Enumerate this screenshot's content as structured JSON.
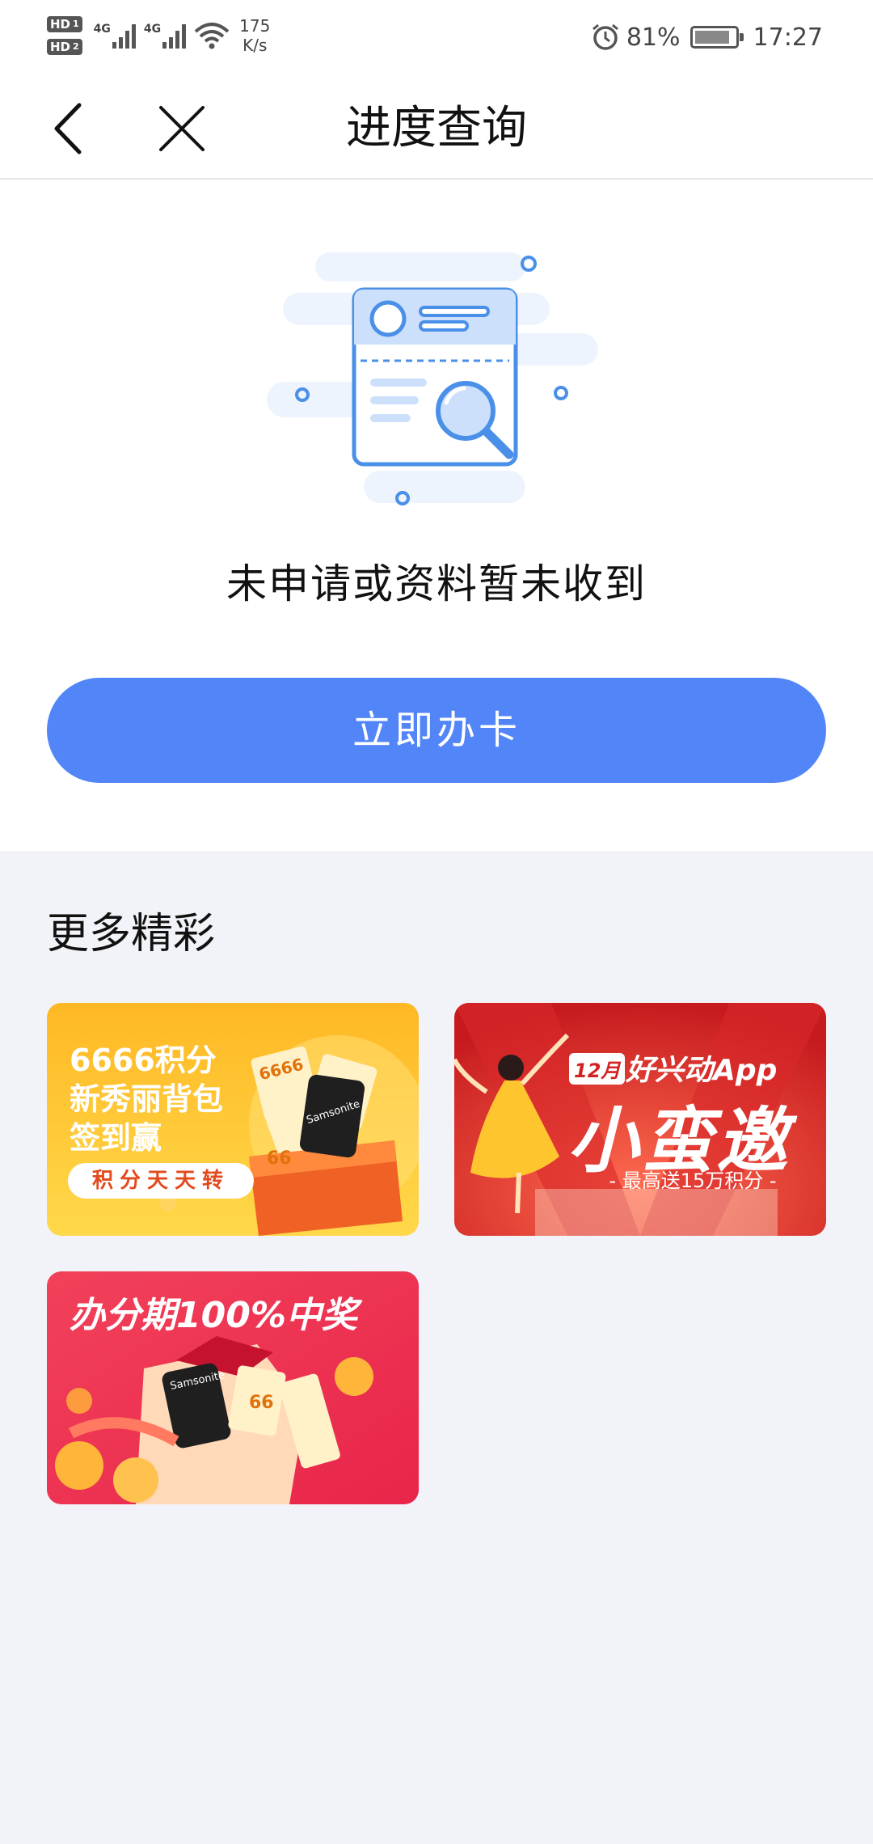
{
  "status_bar": {
    "network_1": "4G",
    "network_2": "4G",
    "hd_1": "HD",
    "hd_1_sub": "1",
    "hd_2": "HD",
    "hd_2_sub": "2",
    "speed_value": "175",
    "speed_unit": "K/s",
    "battery": "81%",
    "time": "17:27"
  },
  "nav": {
    "title": "进度查询"
  },
  "main": {
    "status_message": "未申请或资料暂未收到",
    "apply_button": "立即办卡"
  },
  "more": {
    "title": "更多精彩",
    "banners": [
      {
        "line1": "6666积分",
        "line2": "新秀丽背包",
        "line3": "签到赢",
        "tag": "积分天天转",
        "brand": "Samsonite",
        "coin1": "6666",
        "coin2": "66"
      },
      {
        "badge": "12月",
        "headline": "好兴动App",
        "big": "小蛮邀",
        "sub": "- 最高送15万积分 -"
      },
      {
        "headline": "办分期100%中奖",
        "brand": "Samsonite",
        "coin": "66"
      }
    ]
  },
  "colors": {
    "primary": "#5285f7",
    "page_bg": "#f1f3f8"
  }
}
